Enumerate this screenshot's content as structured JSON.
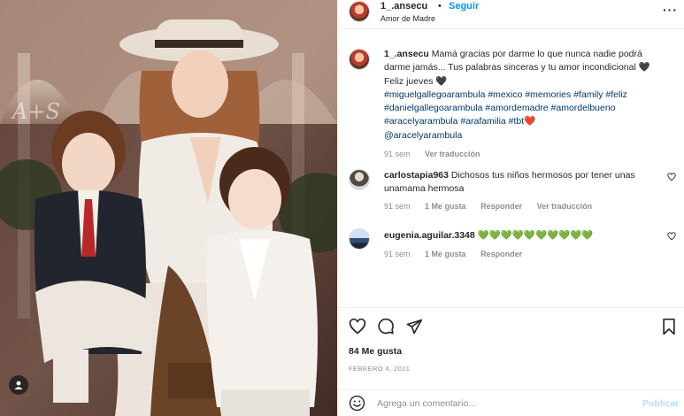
{
  "post": {
    "username": "1_.ansecu",
    "dot": "•",
    "follow_label": "Seguir",
    "subtitle": "Amor de Madre",
    "more_icon": "more-options-icon",
    "watermark": "A+S"
  },
  "caption": {
    "username": "1_.ansecu",
    "text": "Mamá gracias por darme lo que nunca nadie podrá darme jamás... Tus palabras sinceras y tu amor incondicional 🖤 Feliz jueves 🖤",
    "hashtags_line1": "#miguelgallegoarambula #mexico #memories #family #feliz",
    "hashtags_line2": "#danielgallegoarambula #amordemadre #amordelbueno",
    "hashtags_line3": "#aracelyarambula #arafamilia #tbt",
    "hashtags_line3_emoji": "❤️",
    "mention": "@aracelyarambula",
    "time": "91 sem",
    "translate": "Ver traducción"
  },
  "comments": [
    {
      "username": "carlostapia963",
      "text": "Dichosos tus niños hermosos por tener unas unamama hermosa",
      "time": "91 sem",
      "likes": "1 Me gusta",
      "reply": "Responder",
      "translate": "Ver traducción"
    },
    {
      "username": "eugenia.aguilar.3348",
      "text": "💚💚💚💚💚💚💚💚💚💚",
      "time": "91 sem",
      "likes": "1 Me gusta",
      "reply": "Responder"
    }
  ],
  "stats": {
    "likes": "84 Me gusta",
    "date": "FEBRERO 4, 2021"
  },
  "comment_box": {
    "placeholder": "Agrega un comentario...",
    "publish_label": "Publicar"
  },
  "colors": {
    "link": "#0095f6",
    "hashtag": "#00376b",
    "muted": "#8e8e8e",
    "text": "#262626"
  }
}
